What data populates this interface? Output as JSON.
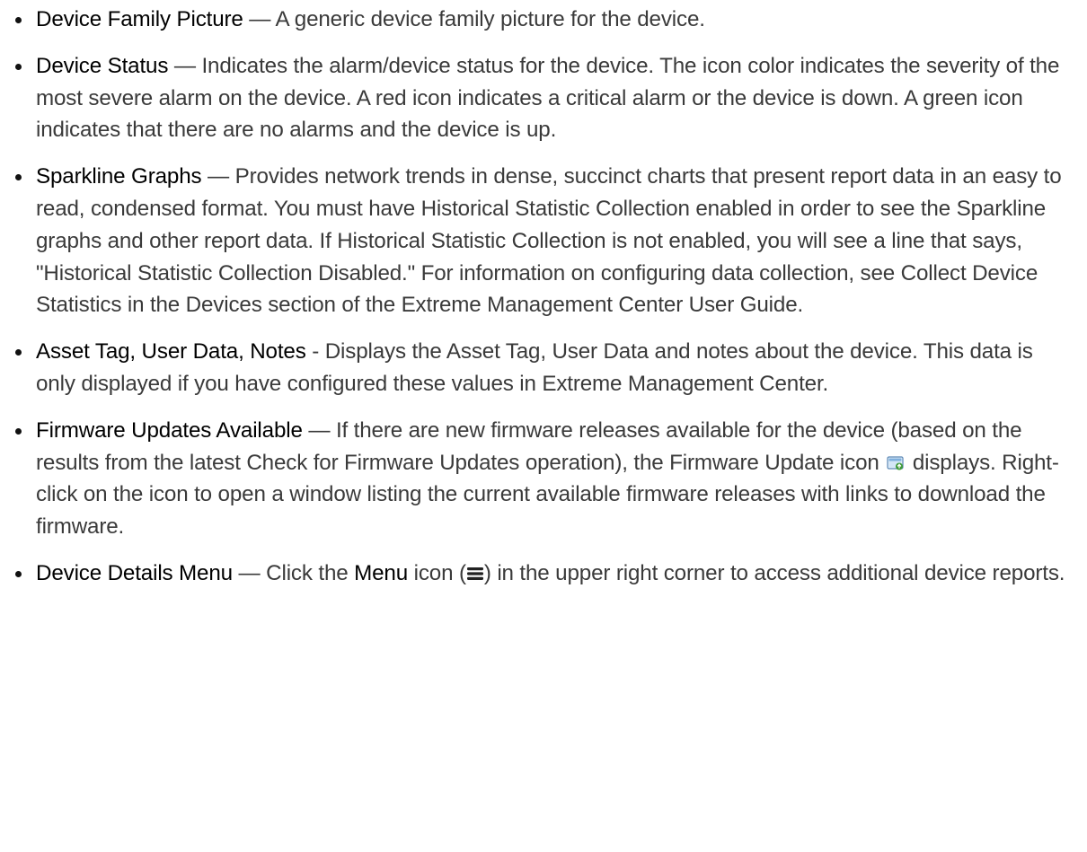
{
  "items": [
    {
      "term": "Device Family Picture",
      "text": " — A generic device family picture for the device."
    },
    {
      "term": "Device Status",
      "text": " — Indicates the alarm/device status for the device. The icon color indicates the severity of the most severe alarm on the device. A red icon indicates a critical alarm or the device is down. A green icon indicates that there are no alarms and the device is up."
    },
    {
      "term": "Sparkline Graphs",
      "text": " — Provides network trends in dense, succinct charts that present report data in an easy to read, condensed format. You must have Historical Statistic Collection enabled in order to see the Sparkline graphs and other report data. If Historical Statistic Collection is not enabled, you will see a line that says, \"Historical Statistic Collection Disabled.\" For information on configuring data collection, see Collect Device Statistics in the Devices section of the Extreme Management Center User Guide."
    },
    {
      "term": "Asset Tag, User Data, Notes",
      "text": " - Displays the Asset Tag, User Data and notes about the device. This data is only displayed if you have configured these values in Extreme Management Center."
    },
    {
      "term": "Firmware Updates Available",
      "text_before_icon": " — If there are new firmware releases available for the device (based on the results from the latest Check for Firmware Updates operation), the Firmware Update icon ",
      "text_after_icon": " displays. Right-click on the icon to open a window listing the current available firmware releases with links to download the firmware.",
      "icon": "firmware-update-icon"
    },
    {
      "term": "Device Details Menu",
      "text_before_strong": " — Click the ",
      "strong": "Menu",
      "text_before_icon": " icon (",
      "icon": "hamburger-menu-icon",
      "text_after_icon": ") in the upper right corner to access additional device reports."
    }
  ]
}
